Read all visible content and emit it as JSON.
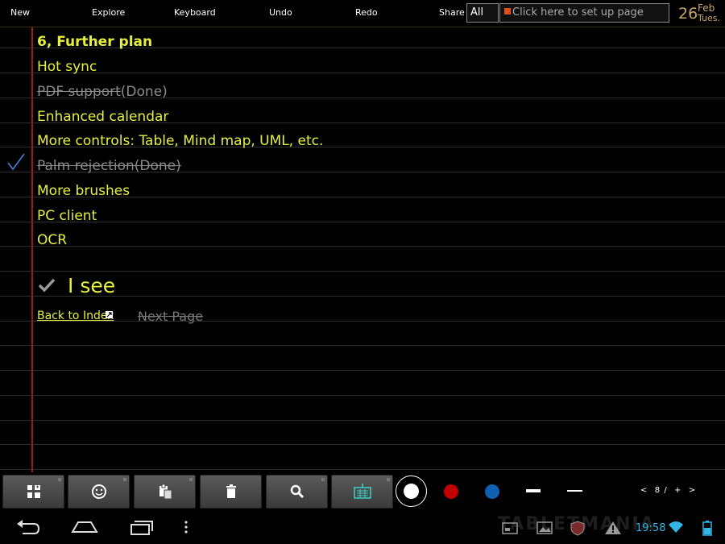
{
  "topbar": {
    "menu": [
      "New",
      "Explore",
      "Keyboard",
      "Undo",
      "Redo",
      "Share"
    ],
    "filter_value": "All",
    "page_setup_placeholder": "Click here to set up page",
    "date": {
      "day": "26",
      "month": "Feb",
      "weekday": "Tues."
    }
  },
  "note": {
    "heading": "6, Further plan",
    "items": [
      {
        "text": "Hot sync",
        "state": "normal"
      },
      {
        "text": "PDF support",
        "suffix": "(Done)",
        "state": "struck-suffix"
      },
      {
        "text": "Enhanced calendar",
        "state": "normal"
      },
      {
        "text": "More controls: Table, Mind map, UML, etc.",
        "state": "normal"
      },
      {
        "text": "Palm rejection(Done)",
        "state": "struck"
      },
      {
        "text": "More brushes",
        "state": "normal"
      },
      {
        "text": "PC client",
        "state": "normal"
      },
      {
        "text": "OCR",
        "state": "normal"
      }
    ],
    "confirm_text": "I see",
    "back_link": "Back to Index",
    "next_page": "Next Page",
    "colors": {
      "text": "#e6f03a",
      "done": "#8a8a8a",
      "margin": "#a01818",
      "check": "#4a7fd4"
    }
  },
  "toolbar": {
    "buttons": [
      "layout-icon",
      "smiley-icon",
      "paste-icon",
      "trash-icon",
      "search-icon",
      "keyboard-icon"
    ],
    "colors": [
      "#ffffff",
      "#c00000",
      "#1060b0"
    ],
    "pager": {
      "prev": "<",
      "page": "8",
      "sep": "/",
      "add": "+",
      "next": ">"
    }
  },
  "navbar": {
    "clock": "19:58",
    "watermark": "TABLETMANIA"
  }
}
